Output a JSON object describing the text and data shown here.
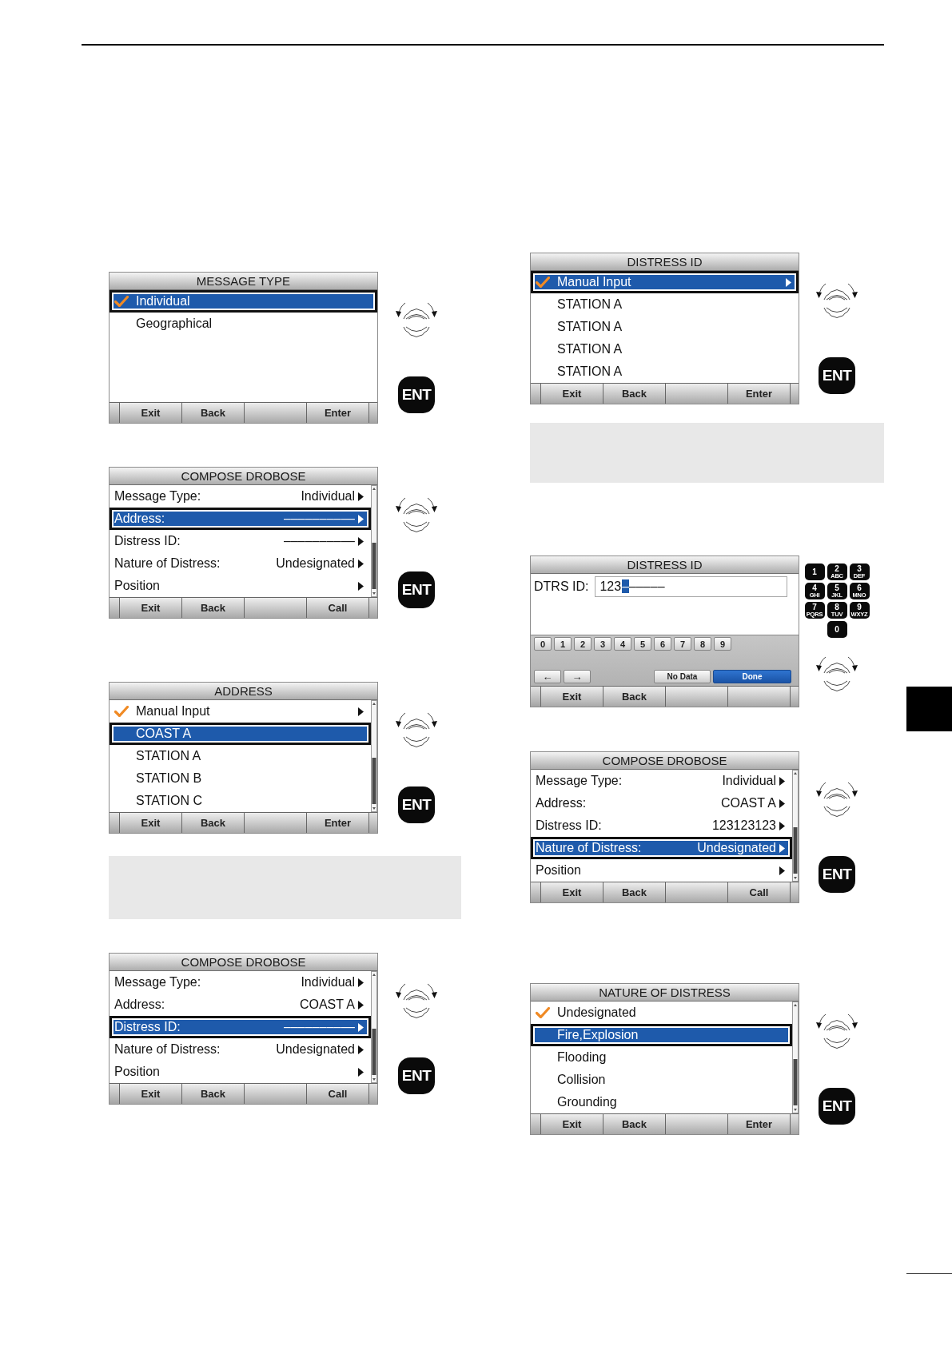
{
  "left_column": [
    {
      "kind": "list_screen",
      "title": "MESSAGE TYPE",
      "scroll_bar": false,
      "rows": [
        {
          "label": "Individual",
          "checked": true,
          "selected": true,
          "submenu": false
        },
        {
          "label": "Geographical",
          "checked": false,
          "selected": false,
          "submenu": false
        }
      ],
      "softkeys": {
        "slot_1": "Exit",
        "slot_2": "Back",
        "slot_4": "Enter"
      },
      "aside": [
        {
          "kind": "dial"
        },
        {
          "kind": "key",
          "label": "ENT"
        }
      ]
    },
    {
      "kind": "form_screen",
      "title": "COMPOSE DROBOSE",
      "scroll_bar": true,
      "rows": [
        {
          "label": "Message Type:",
          "value": "Individual",
          "selected": false,
          "submenu": true
        },
        {
          "label": "Address:",
          "value": "––––––––––",
          "selected": true,
          "submenu": true
        },
        {
          "label": "Distress ID:",
          "value": "––––––––––",
          "selected": false,
          "submenu": true
        },
        {
          "label": "Nature of Distress:",
          "value": "Undesignated",
          "selected": false,
          "submenu": true
        },
        {
          "label": "Position",
          "selected": false,
          "submenu": true
        }
      ],
      "softkeys": {
        "slot_1": "Exit",
        "slot_2": "Back",
        "slot_4": "Call"
      },
      "aside": [
        {
          "kind": "dial"
        },
        {
          "kind": "key",
          "label": "ENT"
        }
      ]
    },
    {
      "kind": "list_screen",
      "title": "ADDRESS",
      "scroll_bar": true,
      "rows": [
        {
          "label": "Manual Input",
          "checked": true,
          "selected": false,
          "submenu": true
        },
        {
          "label": "COAST A",
          "checked": false,
          "selected": true,
          "submenu": false
        },
        {
          "label": "STATION A",
          "checked": false,
          "selected": false,
          "submenu": false
        },
        {
          "label": "STATION B",
          "checked": false,
          "selected": false,
          "submenu": false
        },
        {
          "label": "STATION C",
          "checked": false,
          "selected": false,
          "submenu": false
        }
      ],
      "softkeys": {
        "slot_1": "Exit",
        "slot_2": "Back",
        "slot_4": "Enter"
      },
      "aside": [
        {
          "kind": "dial"
        },
        {
          "kind": "key",
          "label": "ENT"
        }
      ]
    },
    {
      "kind": "panel"
    },
    {
      "kind": "form_screen",
      "title": "COMPOSE DROBOSE",
      "scroll_bar": true,
      "rows": [
        {
          "label": "Message Type:",
          "value": "Individual",
          "selected": false,
          "submenu": true
        },
        {
          "label": "Address:",
          "value": "COAST A",
          "selected": false,
          "submenu": true
        },
        {
          "label": "Distress ID:",
          "value": "––––––––––",
          "selected": true,
          "submenu": true
        },
        {
          "label": "Nature of Distress:",
          "value": "Undesignated",
          "selected": false,
          "submenu": true
        },
        {
          "label": "Position",
          "selected": false,
          "submenu": true
        }
      ],
      "softkeys": {
        "slot_1": "Exit",
        "slot_2": "Back",
        "slot_4": "Call"
      },
      "aside": [
        {
          "kind": "dial"
        },
        {
          "kind": "key",
          "label": "ENT"
        }
      ]
    }
  ],
  "right_column": [
    {
      "kind": "list_screen",
      "title": "DISTRESS ID",
      "scroll_bar": false,
      "rows": [
        {
          "label": "Manual Input",
          "checked": true,
          "selected": true,
          "submenu": true
        },
        {
          "label": "STATION A",
          "checked": false,
          "selected": false,
          "submenu": false
        },
        {
          "label": "STATION A",
          "checked": false,
          "selected": false,
          "submenu": false
        },
        {
          "label": "STATION A",
          "checked": false,
          "selected": false,
          "submenu": false
        },
        {
          "label": "STATION A",
          "checked": false,
          "selected": false,
          "submenu": false
        }
      ],
      "softkeys": {
        "slot_1": "Exit",
        "slot_2": "Back",
        "slot_4": "Enter"
      },
      "aside": [
        {
          "kind": "dial"
        },
        {
          "kind": "key",
          "label": "ENT"
        }
      ]
    },
    {
      "kind": "panel"
    },
    {
      "kind": "entry_screen",
      "title": "DISTRESS ID",
      "field": {
        "label": "DTRS ID:",
        "typed": "123",
        "cursor": "–",
        "remaining": "–––––"
      },
      "digit_keys": [
        "0",
        "1",
        "2",
        "3",
        "4",
        "5",
        "6",
        "7",
        "8",
        "9"
      ],
      "actions": [
        {
          "kind": "move",
          "label": "←",
          "selected": false
        },
        {
          "kind": "move",
          "label": "→",
          "selected": false
        },
        {
          "kind": "command",
          "label": "No Data",
          "selected": false
        },
        {
          "kind": "command",
          "label": "Done",
          "selected": true
        }
      ],
      "softkeys": {
        "slot_1": "Exit",
        "slot_2": "Back"
      },
      "aside": [
        {
          "kind": "keypad",
          "keys": [
            {
              "digit": "1"
            },
            {
              "digit": "2",
              "letters": "ABC"
            },
            {
              "digit": "3",
              "letters": "DEF"
            },
            {
              "digit": "4",
              "letters": "GHI"
            },
            {
              "digit": "5",
              "letters": "JKL"
            },
            {
              "digit": "6",
              "letters": "MNO"
            },
            {
              "digit": "7",
              "letters": "PQRS"
            },
            {
              "digit": "8",
              "letters": "TUV"
            },
            {
              "digit": "9",
              "letters": "WXYZ"
            },
            {
              "digit": "0"
            }
          ]
        },
        {
          "kind": "dial"
        }
      ]
    },
    {
      "kind": "form_screen",
      "title": "COMPOSE DROBOSE",
      "scroll_bar": true,
      "rows": [
        {
          "label": "Message Type:",
          "value": "Individual",
          "selected": false,
          "submenu": true
        },
        {
          "label": "Address:",
          "value": "COAST A",
          "selected": false,
          "submenu": true
        },
        {
          "label": "Distress ID:",
          "value": "123123123",
          "selected": false,
          "submenu": true
        },
        {
          "label": "Nature of Distress:",
          "value": "Undesignated",
          "selected": true,
          "submenu": true
        },
        {
          "label": "Position",
          "selected": false,
          "submenu": true
        }
      ],
      "softkeys": {
        "slot_1": "Exit",
        "slot_2": "Back",
        "slot_4": "Call"
      },
      "aside": [
        {
          "kind": "dial"
        },
        {
          "kind": "key",
          "label": "ENT"
        }
      ]
    },
    {
      "kind": "list_screen",
      "title": "NATURE OF DISTRESS",
      "scroll_bar": true,
      "rows": [
        {
          "label": "Undesignated",
          "checked": true,
          "selected": false,
          "submenu": false
        },
        {
          "label": "Fire,Explosion",
          "checked": false,
          "selected": true,
          "submenu": false
        },
        {
          "label": "Flooding",
          "checked": false,
          "selected": false,
          "submenu": false
        },
        {
          "label": "Collision",
          "checked": false,
          "selected": false,
          "submenu": false
        },
        {
          "label": "Grounding",
          "checked": false,
          "selected": false,
          "submenu": false
        }
      ],
      "softkeys": {
        "slot_1": "Exit",
        "slot_2": "Back",
        "slot_4": "Enter"
      },
      "aside": [
        {
          "kind": "dial"
        },
        {
          "kind": "key",
          "label": "ENT"
        }
      ]
    }
  ]
}
